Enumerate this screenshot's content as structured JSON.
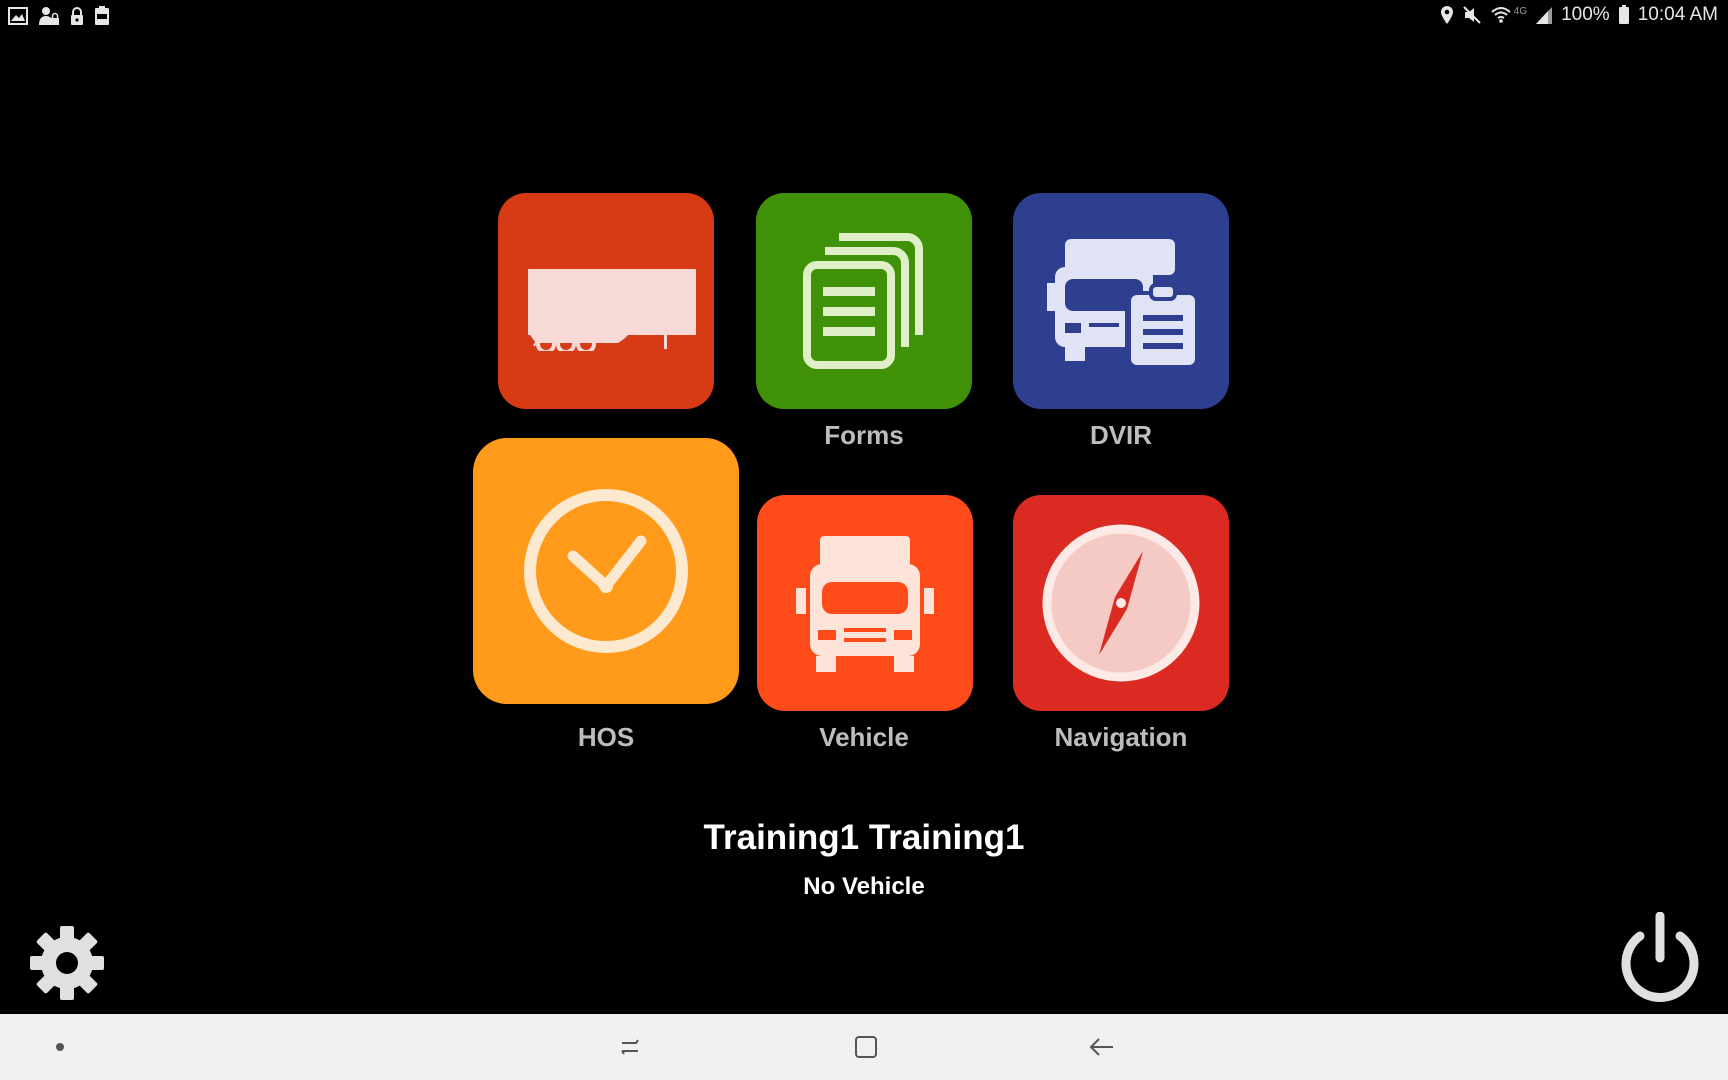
{
  "status_bar": {
    "left_icons": [
      "image-icon",
      "user-lock-icon",
      "lock-icon",
      "battery-100-icon"
    ],
    "right_icons": [
      "location-icon",
      "mute-icon",
      "wifi-icon",
      "signal-icon",
      "battery-icon"
    ],
    "network_label": "4G",
    "battery_percent": "100%",
    "time": "10:04 AM"
  },
  "tiles": [
    {
      "id": "trailer",
      "label": "",
      "icon": "trailer-icon",
      "color": "#d63b16"
    },
    {
      "id": "forms",
      "label": "Forms",
      "icon": "documents-icon",
      "color": "#3f9207"
    },
    {
      "id": "dvir",
      "label": "DVIR",
      "icon": "truck-clipboard-icon",
      "color": "#2f3f8f"
    },
    {
      "id": "hos",
      "label": "HOS",
      "icon": "clock-icon",
      "color": "#ff9a1a"
    },
    {
      "id": "vehicle",
      "label": "Vehicle",
      "icon": "truck-icon",
      "color": "#ff4a1a"
    },
    {
      "id": "navigation",
      "label": "Navigation",
      "icon": "compass-icon",
      "color": "#da2a22"
    }
  ],
  "user": {
    "name": "Training1 Training1",
    "vehicle_status": "No Vehicle"
  },
  "controls": {
    "settings_icon": "gear-icon",
    "power_icon": "power-icon"
  },
  "nav_bar": {
    "items": [
      "dot-icon",
      "recents-icon",
      "home-icon",
      "back-icon"
    ]
  }
}
